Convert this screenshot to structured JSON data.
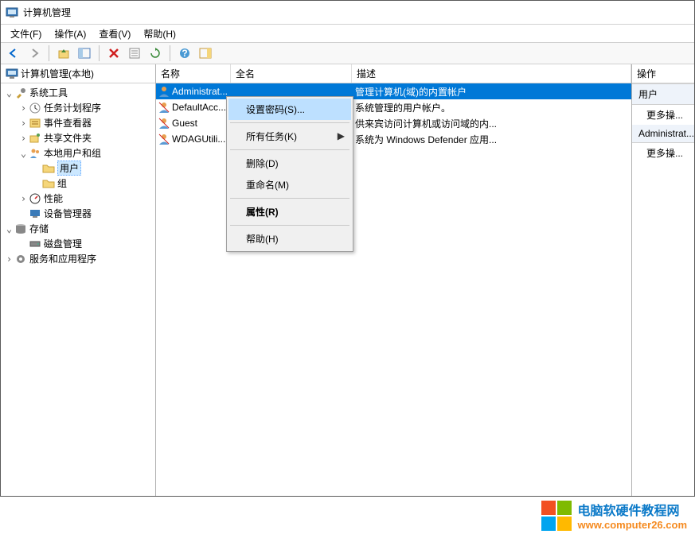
{
  "window": {
    "title": "计算机管理"
  },
  "menus": {
    "file": "文件(F)",
    "action": "操作(A)",
    "view": "查看(V)",
    "help": "帮助(H)"
  },
  "tree_header": "计算机管理(本地)",
  "tree": {
    "root": "计算机管理(本地)",
    "system_tools": "系统工具",
    "task_scheduler": "任务计划程序",
    "event_viewer": "事件查看器",
    "shared_folders": "共享文件夹",
    "local_users": "本地用户和组",
    "users": "用户",
    "groups": "组",
    "performance": "性能",
    "device_manager": "设备管理器",
    "storage": "存储",
    "disk_mgmt": "磁盘管理",
    "services_apps": "服务和应用程序"
  },
  "list": {
    "columns": {
      "name": "名称",
      "fullname": "全名",
      "description": "描述"
    },
    "rows": [
      {
        "name": "Administrat...",
        "full": "",
        "desc": "管理计算机(域)的内置帐户"
      },
      {
        "name": "DefaultAcc...",
        "full": "",
        "desc": "系统管理的用户帐户。"
      },
      {
        "name": "Guest",
        "full": "",
        "desc": "供来宾访问计算机或访问域的内..."
      },
      {
        "name": "WDAGUtili...",
        "full": "",
        "desc": "系统为 Windows Defender 应用..."
      }
    ]
  },
  "context_menu": {
    "set_password": "设置密码(S)...",
    "all_tasks": "所有任务(K)",
    "delete": "删除(D)",
    "rename": "重命名(M)",
    "properties": "属性(R)",
    "help": "帮助(H)"
  },
  "actions": {
    "header": "操作",
    "section1": "用户",
    "more1": "更多操...",
    "section2": "Administrat...",
    "more2": "更多操..."
  },
  "footer": {
    "line1": "电脑软硬件教程网",
    "line2": "www.computer26.com"
  }
}
